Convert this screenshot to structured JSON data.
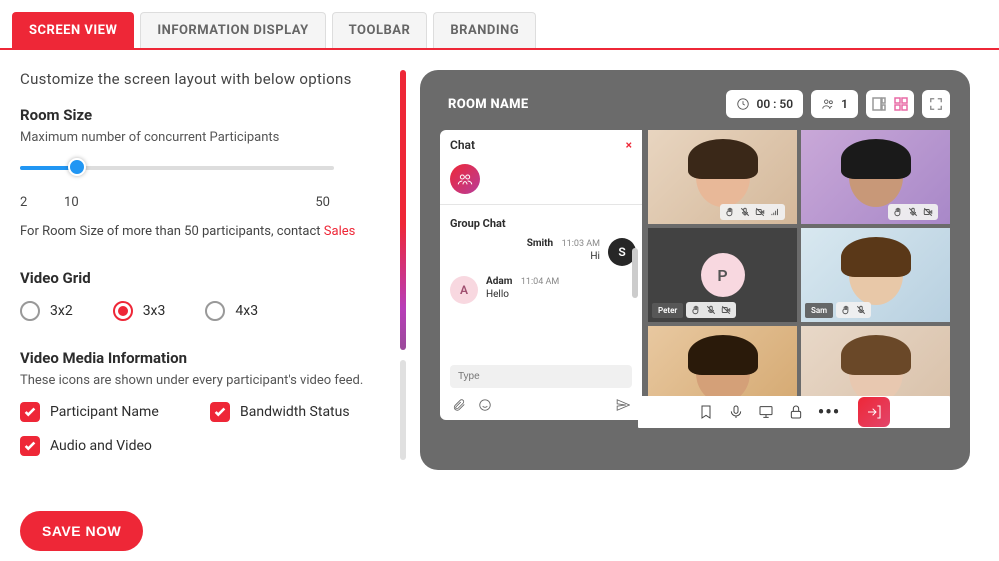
{
  "tabs": {
    "screen_view": "SCREEN VIEW",
    "info_display": "INFORMATION DISPLAY",
    "toolbar": "TOOLBAR",
    "branding": "BRANDING"
  },
  "left": {
    "subtitle": "Customize the screen layout with below options",
    "room_size_title": "Room Size",
    "room_size_help": "Maximum number of concurrent Participants",
    "slider": {
      "min": "2",
      "value": "10",
      "max": "50"
    },
    "note_prefix": "For Room Size of more than 50 participants, contact ",
    "note_link": "Sales",
    "video_grid_title": "Video Grid",
    "grid_options": {
      "a": "3x2",
      "b": "3x3",
      "c": "4x3"
    },
    "media_info_title": "Video Media Information",
    "media_info_help": "These icons are shown under every participant's video feed.",
    "checks": {
      "participant_name": "Participant Name",
      "bandwidth": "Bandwidth Status",
      "audio_video": "Audio and Video"
    },
    "save": "SAVE NOW"
  },
  "preview": {
    "room_name": "ROOM NAME",
    "timer": "00 : 50",
    "count": "1",
    "chat": {
      "title": "Chat",
      "group_title": "Group Chat",
      "msgs": [
        {
          "avatar": "S",
          "name": "Smith",
          "time": "11:03 AM",
          "text": "Hi"
        },
        {
          "avatar": "A",
          "name": "Adam",
          "time": "11:04 AM",
          "text": "Hello"
        }
      ],
      "input_placeholder": "Type"
    },
    "participant_p": "P",
    "name_tags": {
      "peter": "Peter",
      "sam": "Sam"
    }
  }
}
